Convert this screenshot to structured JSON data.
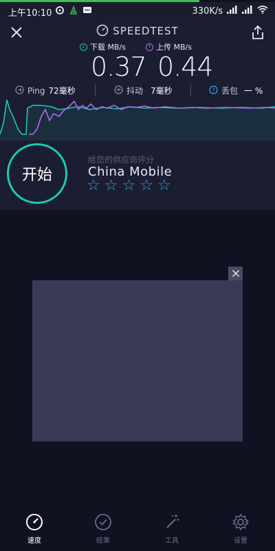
{
  "status_bar": {
    "time": "上午10:10",
    "net_speed": "330K/s"
  },
  "header": {
    "brand": "SPEEDTEST"
  },
  "download": {
    "label": "下载 MB/s",
    "value": "0.37",
    "color": "#1ec8b4"
  },
  "upload": {
    "label": "上传 MB/s",
    "value": "0.44",
    "color": "#b06bf0"
  },
  "metrics": {
    "ping_label": "Ping",
    "ping_value": "72毫秒",
    "jitter_label": "抖动",
    "jitter_value": "7毫秒",
    "loss_label": "丢包",
    "loss_value": "一 %"
  },
  "start_button": "开始",
  "rating": {
    "prompt": "给您的供应商评分",
    "provider": "China Mobile",
    "stars": 5
  },
  "nav": {
    "tabs": [
      {
        "label": "速度",
        "icon": "speed-gauge-icon",
        "active": true
      },
      {
        "label": "结果",
        "icon": "checkmark-circle-icon",
        "active": false
      },
      {
        "label": "工具",
        "icon": "magic-wand-icon",
        "active": false
      },
      {
        "label": "设置",
        "icon": "gear-icon",
        "active": false
      }
    ]
  },
  "colors": {
    "accent_teal": "#1ec8b4",
    "accent_purple": "#b06bf0",
    "star_blue": "#2ea6e8",
    "ad_background": "#393a58"
  }
}
